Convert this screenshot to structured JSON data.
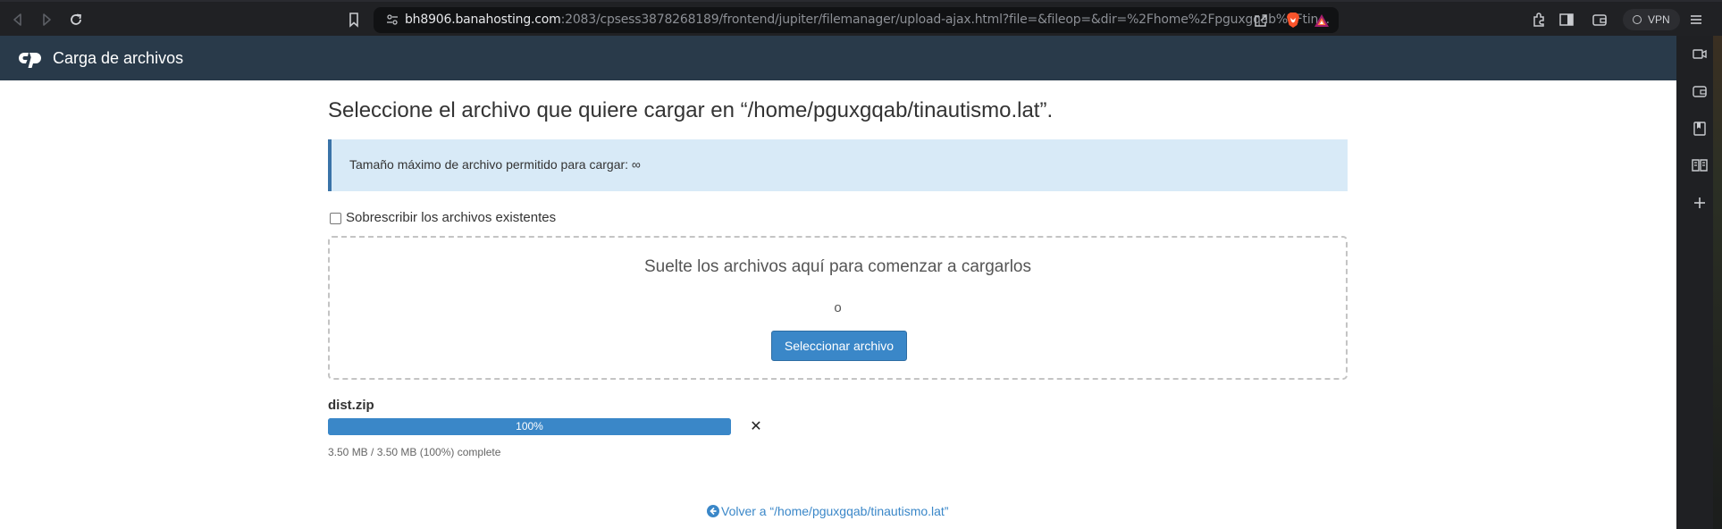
{
  "browser": {
    "url_host": "bh8906.banahosting.com",
    "url_rest": ":2083/cpsess3878268189/frontend/jupiter/filemanager/upload-ajax.html?file=&fileop=&dir=%2Fhome%2Fpguxgqab%2Ftin...",
    "vpn_label": "VPN"
  },
  "header": {
    "title": "Carga de archivos"
  },
  "main": {
    "heading": "Seleccione el archivo que quiere cargar en “/home/pguxgqab/tinautismo.lat”.",
    "info": "Tamaño máximo de archivo permitido para cargar: ∞",
    "overwrite_label": "Sobrescribir los archivos existentes",
    "overwrite_checked": false,
    "dropzone_title": "Suelte los archivos aquí para comenzar a cargarlos",
    "dropzone_or": "o",
    "select_button": "Seleccionar archivo"
  },
  "upload": {
    "file_name": "dist.zip",
    "progress_percent": 100,
    "progress_label": "100%",
    "status": "3.50 MB / 3.50 MB (100%) complete",
    "remove_glyph": "✕"
  },
  "footer": {
    "back_link": "Volver a “/home/pguxgqab/tinautismo.lat”"
  },
  "colors": {
    "header_bg": "#293a4a",
    "accent": "#3a87c8",
    "info_bg": "#d8eaf7"
  }
}
